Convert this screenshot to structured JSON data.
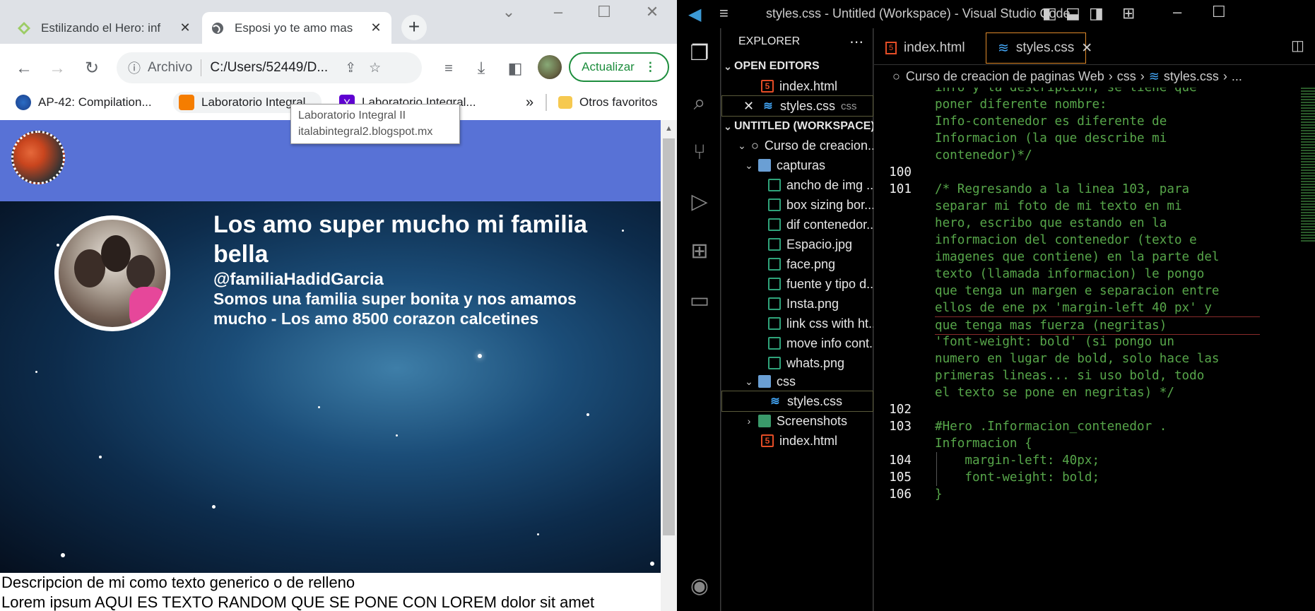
{
  "browser": {
    "tabs": [
      {
        "title": "Estilizando el Hero: inf"
      },
      {
        "title": "Esposi yo te amo mas"
      }
    ],
    "address": {
      "scheme": "Archivo",
      "url": "C:/Users/52449/D..."
    },
    "update_label": "Actualizar",
    "bookmarks": [
      {
        "label": "AP-42: Compilation..."
      },
      {
        "label": "Laboratorio Integral..."
      },
      {
        "label": "Laboratorio Integral..."
      }
    ],
    "more_bookmarks": "»",
    "other_favorites": "Otros favoritos",
    "tooltip": {
      "title": "Laboratorio Integral II",
      "url": "italabintegral2.blogspot.mx"
    }
  },
  "page": {
    "hero_name": "Los amo super mucho mi familia bella",
    "hero_user": "@familiaHadidGarcia",
    "hero_desc": "Somos una familia super bonita y nos amamos mucho - Los amo 8500 corazon calcetines",
    "body_line1": "Descripcion de mi como texto generico o de relleno",
    "body_line2": "Lorem ipsum AQUI ES TEXTO RANDOM QUE SE PONE CON LOREM dolor sit amet"
  },
  "vscode": {
    "window_title": "styles.css - Untitled (Workspace) - Visual Studio Code",
    "explorer_title": "EXPLORER",
    "open_editors_title": "OPEN EDITORS",
    "open_editors": [
      {
        "name": "index.html",
        "extra": ""
      },
      {
        "name": "styles.css",
        "extra": "css"
      }
    ],
    "workspace_title": "UNTITLED (WORKSPACE)",
    "tree": {
      "root": "Curso de creacion...",
      "capturas": "capturas",
      "captures": [
        "ancho de img ...",
        "box sizing bor...",
        "dif contenedor...",
        "Espacio.jpg",
        "face.png",
        "fuente y tipo d...",
        "Insta.png",
        "link css with ht...",
        "move info cont...",
        "whats.png"
      ],
      "css_folder": "css",
      "css_file": "styles.css",
      "screenshots": "Screenshots",
      "index": "index.html"
    },
    "editor_tabs": [
      {
        "name": "index.html"
      },
      {
        "name": "styles.css"
      }
    ],
    "breadcrumb": [
      "Curso de creacion de paginas Web",
      "css",
      "styles.css",
      "..."
    ],
    "code_lines": [
      {
        "ln": "",
        "text": "info y la descripcion, se tiene que"
      },
      {
        "ln": "",
        "text": "poner diferente nombre:"
      },
      {
        "ln": "",
        "text": "Info-contenedor es diferente de"
      },
      {
        "ln": "",
        "text": "Informacion (la que describe mi"
      },
      {
        "ln": "",
        "text": "contenedor)*/"
      },
      {
        "ln": "100",
        "text": ""
      },
      {
        "ln": "101",
        "text": "/* Regresando a la linea 103, para"
      },
      {
        "ln": "",
        "text": "separar mi foto de mi texto en mi"
      },
      {
        "ln": "",
        "text": "hero, escribo que estando en la"
      },
      {
        "ln": "",
        "text": "informacion del contenedor (texto e"
      },
      {
        "ln": "",
        "text": "imagenes que contiene) en la parte del"
      },
      {
        "ln": "",
        "text": "texto (llamada informacion) le pongo"
      },
      {
        "ln": "",
        "text": "que tenga un margen e separacion entre"
      },
      {
        "ln": "",
        "text": "ellos de ene px 'margin-left 40 px' y"
      },
      {
        "ln": "",
        "text": "que tenga mas fuerza (negritas)"
      },
      {
        "ln": "",
        "text": "'font-weight: bold' (si pongo un"
      },
      {
        "ln": "",
        "text": "numero en lugar de bold, solo hace las"
      },
      {
        "ln": "",
        "text": "primeras lineas... si uso bold, todo"
      },
      {
        "ln": "",
        "text": "el texto se pone en negritas) */"
      },
      {
        "ln": "102",
        "text": ""
      },
      {
        "ln": "103",
        "text": "#Hero .Informacion_contenedor ."
      },
      {
        "ln": "",
        "text": "Informacion {"
      },
      {
        "ln": "104",
        "text": "    margin-left: 40px;"
      },
      {
        "ln": "105",
        "text": "    font-weight: bold;"
      },
      {
        "ln": "106",
        "text": "}"
      }
    ]
  },
  "colors": {
    "chrome_accent": "#1e8e3e",
    "site_header": "#5872d6",
    "comment": "#57a64a",
    "selector": "#d7ba7d"
  }
}
